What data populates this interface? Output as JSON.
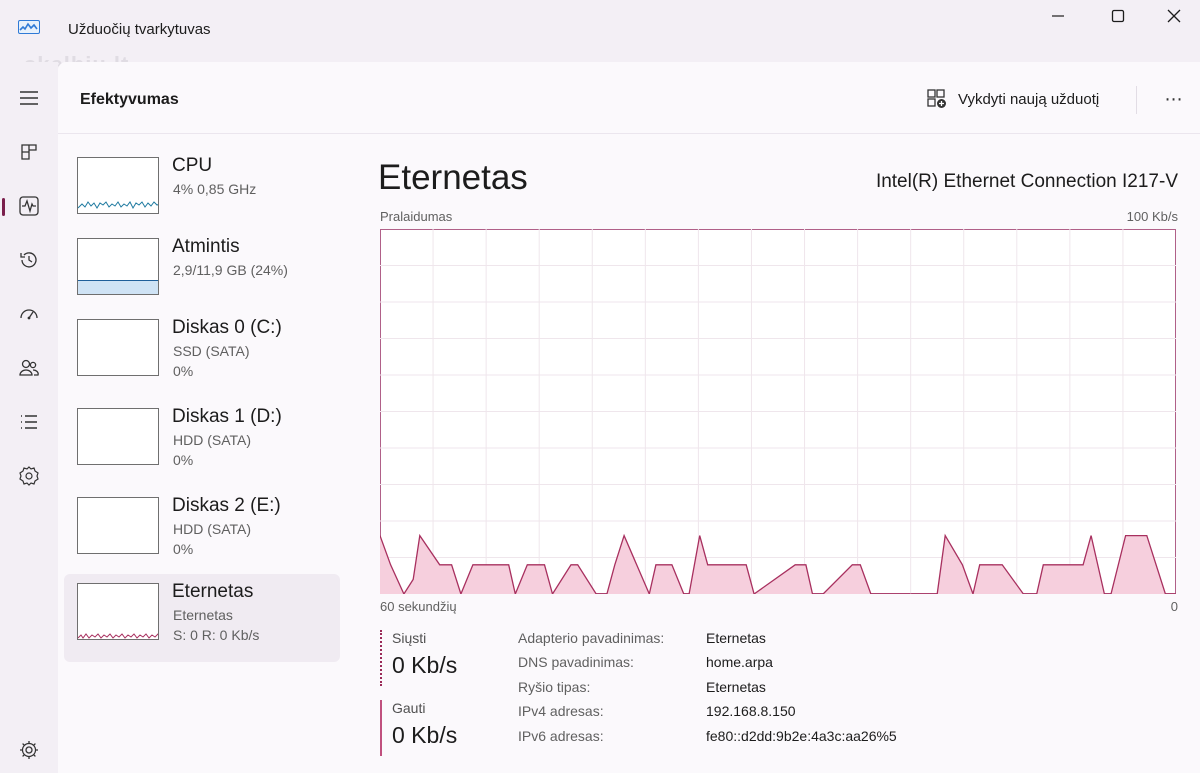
{
  "window": {
    "title": "Užduočių tvarkytuvas",
    "watermark": "skelbiu.lt",
    "icons": {
      "app": "task-manager-icon",
      "minimize": "minimize-icon",
      "maximize": "maximize-icon",
      "close": "close-icon"
    }
  },
  "rail": {
    "items": [
      {
        "name": "menu",
        "icon": "hamburger-icon",
        "active": false
      },
      {
        "name": "processes",
        "icon": "processes-icon",
        "active": false
      },
      {
        "name": "performance",
        "icon": "performance-icon",
        "active": true
      },
      {
        "name": "app-history",
        "icon": "history-icon",
        "active": false
      },
      {
        "name": "startup-apps",
        "icon": "startup-icon",
        "active": false
      },
      {
        "name": "users",
        "icon": "users-icon",
        "active": false
      },
      {
        "name": "details",
        "icon": "details-list-icon",
        "active": false
      },
      {
        "name": "services",
        "icon": "services-icon",
        "active": false
      },
      {
        "name": "settings",
        "icon": "settings-gear-icon",
        "active": false
      }
    ]
  },
  "header": {
    "title": "Efektyvumas",
    "new_task_label": "Vykdyti naują užduotį",
    "more_label": "⋯"
  },
  "devices": [
    {
      "name": "CPU",
      "line2": "4% 0,85 GHz",
      "line3": "",
      "selected": false
    },
    {
      "name": "Atmintis",
      "line2": "2,9/11,9 GB (24%)",
      "line3": "",
      "selected": false
    },
    {
      "name": "Diskas 0 (C:)",
      "line2": "SSD (SATA)",
      "line3": "0%",
      "selected": false
    },
    {
      "name": "Diskas 1 (D:)",
      "line2": "HDD (SATA)",
      "line3": "0%",
      "selected": false
    },
    {
      "name": "Diskas 2 (E:)",
      "line2": "HDD (SATA)",
      "line3": "0%",
      "selected": false
    },
    {
      "name": "Eternetas",
      "line2": "Eternetas",
      "line3": "S: 0 R: 0 Kb/s",
      "selected": true
    }
  ],
  "detail": {
    "title": "Eternetas",
    "adapter": "Intel(R) Ethernet Connection I217-V",
    "chart_label": "Pralaidumas",
    "max_label": "100 Kb/s",
    "x_left_label": "60 sekundžių",
    "x_right_label": "0",
    "send_label": "Siųsti",
    "send_value": "0 Kb/s",
    "receive_label": "Gauti",
    "receive_value": "0 Kb/s",
    "properties": [
      {
        "key": "Adapterio pavadinimas:",
        "value": "Eternetas"
      },
      {
        "key": "DNS pavadinimas:",
        "value": "home.arpa"
      },
      {
        "key": "Ryšio tipas:",
        "value": "Eternetas"
      },
      {
        "key": "IPv4 adresas:",
        "value": "192.168.8.150"
      },
      {
        "key": "IPv6 adresas:",
        "value": "fe80::d2dd:9b2e:4a3c:aa26%5"
      }
    ]
  },
  "colors": {
    "accent": "#7a1f4c",
    "ethernet_line": "#a8305f",
    "ethernet_fill": "#f6cfdd",
    "cpu_line": "#1f7aa0",
    "memory_fill": "#cfe3f5"
  },
  "chart_data": {
    "type": "area",
    "ylim": [
      0,
      100
    ],
    "xlim": [
      60,
      0
    ],
    "unit": "Kb/s",
    "series": [
      {
        "x": [
          60,
          59.2,
          58.2,
          57.5,
          57,
          55.5,
          54.6,
          53.9,
          53,
          50.3,
          49.8,
          48.9,
          47.6,
          47,
          45.6,
          45.1,
          43.7,
          42.9,
          42.3,
          41.6,
          39.7,
          39.2,
          38,
          37.1,
          36.7,
          35.9,
          35.3,
          33.8,
          32.4,
          31.8,
          28.7,
          27.9,
          27.4,
          26.6,
          24.4,
          23.8,
          23,
          18,
          17.4,
          16.1,
          15.3,
          14.8,
          13.6,
          13.1,
          11.5,
          10.5,
          10,
          7.8,
          7,
          6.4,
          5.4,
          4.9,
          3.8,
          2.2,
          1.5,
          0.8,
          0
        ],
        "y": [
          16,
          8,
          0,
          4,
          16,
          8,
          8,
          0,
          8,
          8,
          0,
          8,
          8,
          0,
          8,
          8,
          0,
          0,
          8,
          16,
          0,
          8,
          8,
          0,
          0,
          16,
          8,
          8,
          8,
          0,
          8,
          8,
          0,
          0,
          8,
          8,
          0,
          0,
          16,
          8,
          0,
          8,
          8,
          8,
          0,
          0,
          8,
          8,
          8,
          16,
          0,
          0,
          16,
          16,
          8,
          0,
          0
        ]
      }
    ]
  }
}
